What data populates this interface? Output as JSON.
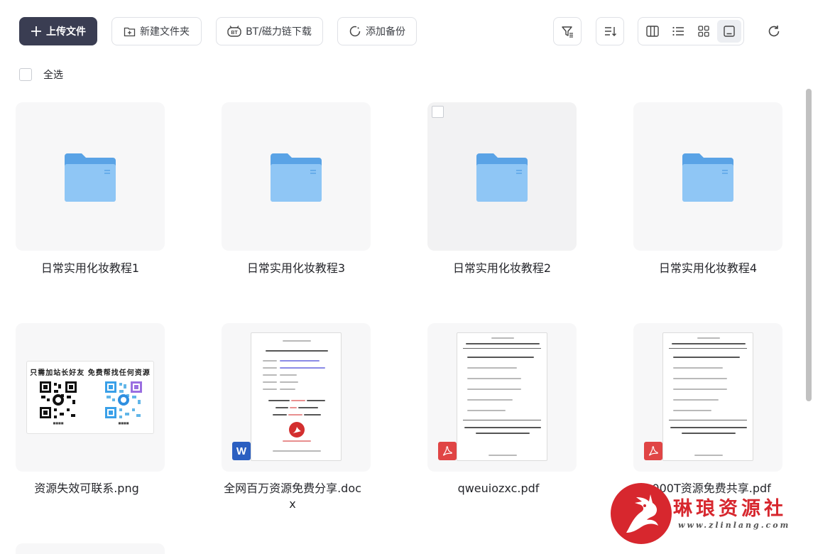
{
  "toolbar": {
    "upload_label": "上传文件",
    "new_folder_label": "新建文件夹",
    "bt_label": "BT/磁力链下载",
    "backup_label": "添加备份"
  },
  "select_all_label": "全选",
  "files": [
    {
      "name": "日常实用化妆教程1",
      "type": "folder"
    },
    {
      "name": "日常实用化妆教程3",
      "type": "folder"
    },
    {
      "name": "日常实用化妆教程2",
      "type": "folder"
    },
    {
      "name": "日常实用化妆教程4",
      "type": "folder"
    },
    {
      "name": "资源失效可联系.png",
      "type": "image",
      "thumb_text": "只需加站长好友 免费帮找任何资源"
    },
    {
      "name": "全网百万资源免费分享.docx",
      "type": "docx"
    },
    {
      "name": "qweuiozxc.pdf",
      "type": "pdf"
    },
    {
      "name": "1000T资源免费共享.pdf",
      "type": "pdf"
    }
  ],
  "view_mode": "thumbnail",
  "watermark": {
    "title": "琳琅资源社",
    "url": "www.zlinlang.com"
  },
  "colors": {
    "primary_button": "#3a3d52",
    "folder": "#6aaeea",
    "pdf_badge": "#e04545",
    "word_badge": "#2b5fc1",
    "watermark_red": "#d7272e"
  }
}
